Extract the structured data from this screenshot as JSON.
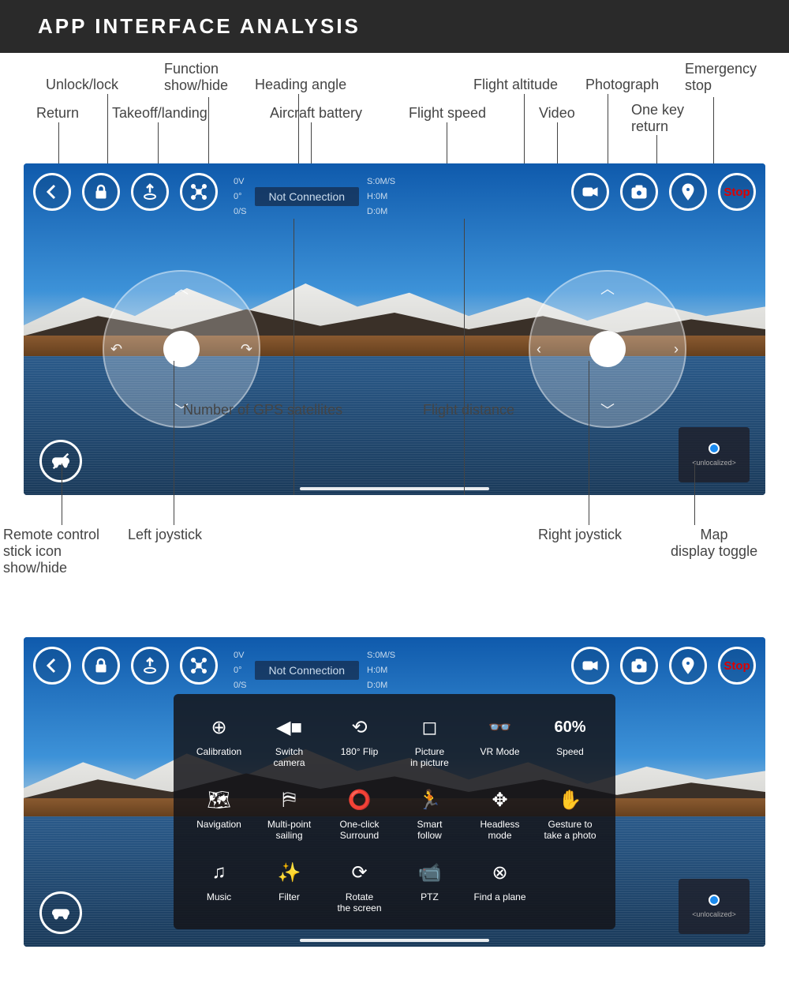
{
  "header": {
    "title": "APP INTERFACE ANALYSIS"
  },
  "callouts_top": {
    "return": "Return",
    "unlock_lock": "Unlock/lock",
    "takeoff_landing": "Takeoff/landing",
    "function_show_hide": "Function\nshow/hide",
    "heading_angle": "Heading angle",
    "aircraft_battery": "Aircraft battery",
    "gps_satellites": "Number of GPS satellites",
    "flight_speed": "Flight speed",
    "flight_altitude": "Flight altitude",
    "flight_distance": "Flight distance",
    "video": "Video",
    "photograph": "Photograph",
    "one_key_return": "One key\nreturn",
    "emergency_stop": "Emergency\nstop"
  },
  "callouts_bottom": {
    "remote_stick_toggle": "Remote control\nstick icon\nshow/hide",
    "left_joystick": "Left joystick",
    "right_joystick": "Right joystick",
    "map_toggle": "Map\ndisplay toggle"
  },
  "telemetry": {
    "battery": "0V",
    "heading": "0°",
    "satellites": "0/S",
    "speed": "S:0M/S",
    "altitude": "H:0M",
    "distance": "D:0M",
    "connection": "Not Connection"
  },
  "stop_label": "Stop",
  "map_widget": {
    "label": "<unlocalized>"
  },
  "functions": {
    "calibration": "Calibration",
    "switch_camera": "Switch\ncamera",
    "flip180": "180° Flip",
    "pip": "Picture\nin picture",
    "vr_mode": "VR Mode",
    "speed": "Speed",
    "speed_value": "60%",
    "navigation": "Navigation",
    "multipoint": "Multi-point\nsailing",
    "surround": "One-click\nSurround",
    "smart_follow": "Smart\nfollow",
    "headless": "Headless\nmode",
    "gesture": "Gesture to\ntake a photo",
    "music": "Music",
    "filter": "Filter",
    "rotate": "Rotate\nthe screen",
    "ptz": "PTZ",
    "find_plane": "Find a plane"
  }
}
